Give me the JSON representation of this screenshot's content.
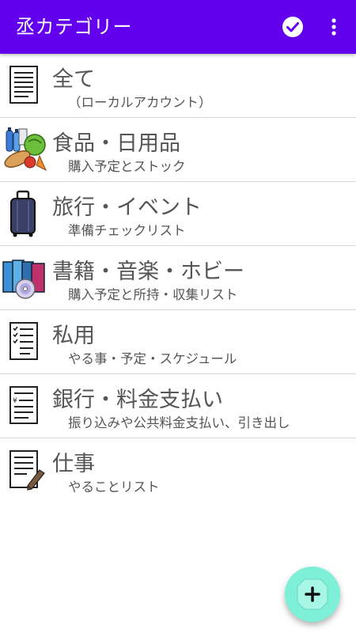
{
  "appbar": {
    "title": "丞カテゴリー",
    "check_icon": "check-circle-icon",
    "more_icon": "more-vert-icon"
  },
  "categories": [
    {
      "title": "全て",
      "subtitle": "（ローカルアカウント）",
      "icon": "document-lines-icon"
    },
    {
      "title": "食品・日用品",
      "subtitle": "購入予定とストック",
      "icon": "groceries-icon"
    },
    {
      "title": "旅行・イベント",
      "subtitle": "準備チェックリスト",
      "icon": "suitcase-icon"
    },
    {
      "title": "書籍・音楽・ホビー",
      "subtitle": "購入予定と所持・収集リスト",
      "icon": "books-cd-icon"
    },
    {
      "title": "私用",
      "subtitle": "やる事・予定・スケジュール",
      "icon": "checklist-document-icon"
    },
    {
      "title": "銀行・料金支払い",
      "subtitle": "振り込みや公共料金支払い、引き出し",
      "icon": "yen-document-icon"
    },
    {
      "title": "仕事",
      "subtitle": "やることリスト",
      "icon": "document-pen-icon"
    }
  ],
  "fab": {
    "icon": "add-icon"
  },
  "colors": {
    "appbar": "#6200ee",
    "fab": "#7ff0d8",
    "text": "#555555",
    "divider": "#d8d8d8"
  }
}
